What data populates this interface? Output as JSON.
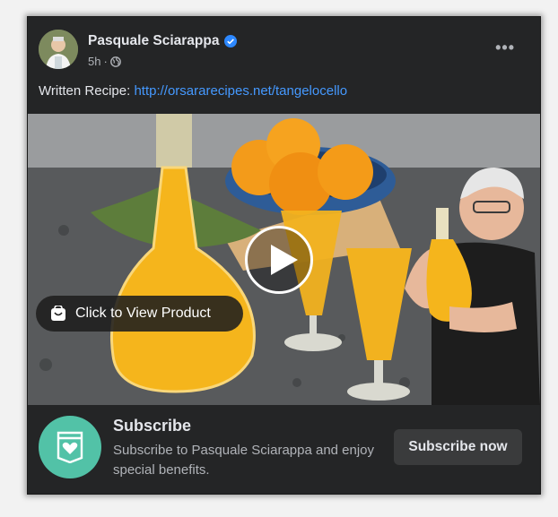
{
  "post": {
    "author_name": "Pasquale Sciarappa",
    "timestamp": "5h",
    "separator": "·",
    "caption_prefix": "Written Recipe: ",
    "caption_link": "http://orsararecipes.net/tangelocello"
  },
  "media": {
    "product_pill_label": "Click to View Product"
  },
  "subscribe": {
    "title": "Subscribe",
    "description": "Subscribe to Pasquale Sciarappa and enjoy special benefits.",
    "button_label": "Subscribe now"
  },
  "icons": {
    "verified": "verified-badge-icon",
    "audience": "globe-icon",
    "more": "more-options-icon",
    "play": "play-icon",
    "product": "shopping-bag-icon",
    "subscribe": "subscribe-heart-badge-icon"
  },
  "colors": {
    "card_bg": "#242526",
    "link": "#4599ff",
    "verified": "#2d88ff",
    "subscribe_icon_bg": "#52c2a7",
    "button_bg": "#3a3b3c"
  }
}
